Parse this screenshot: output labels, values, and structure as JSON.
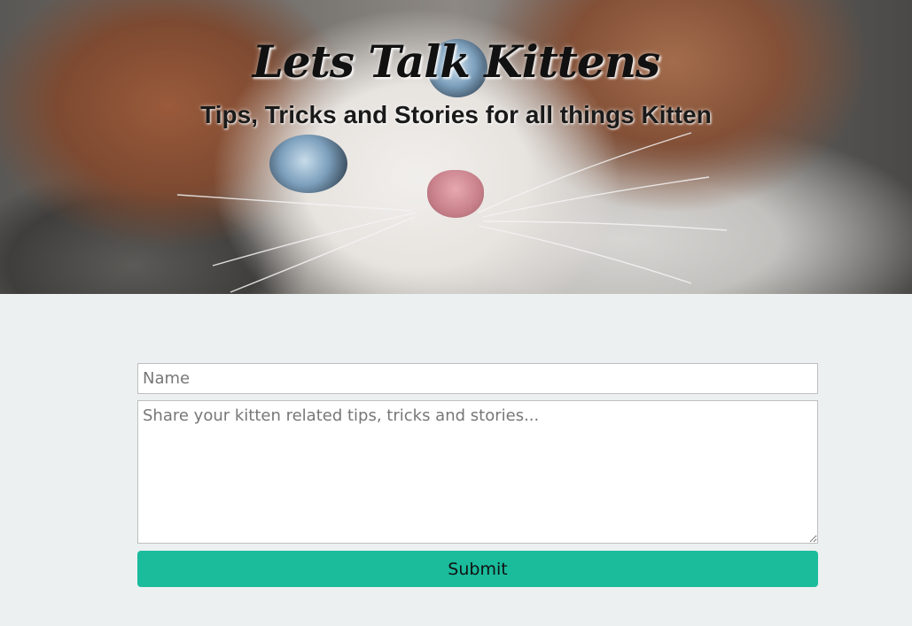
{
  "header": {
    "title": "Lets Talk Kittens",
    "subtitle": "Tips, Tricks and Stories for all things Kitten"
  },
  "form": {
    "name_placeholder": "Name",
    "message_placeholder": "Share your kitten related tips, tricks and stories...",
    "submit_label": "Submit"
  },
  "colors": {
    "background": "#ecf0f1",
    "submit_button": "#1abc9c"
  }
}
